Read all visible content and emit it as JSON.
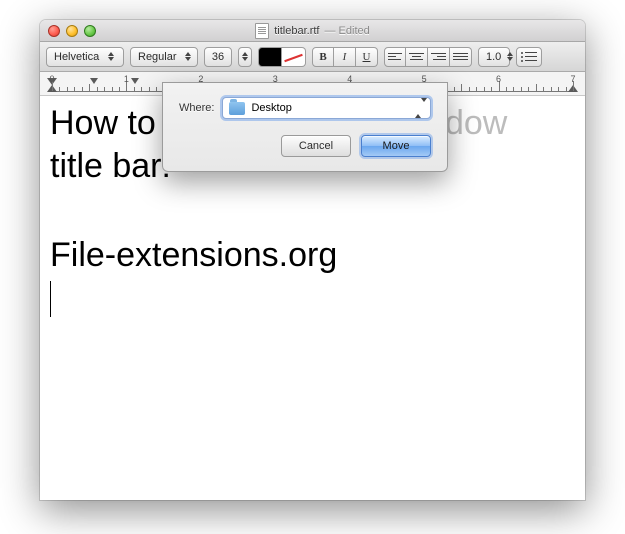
{
  "title": {
    "filename": "titlebar.rtf",
    "edited": "— Edited"
  },
  "toolbar": {
    "font_family": "Helvetica",
    "font_style": "Regular",
    "font_size": "36",
    "b": "B",
    "i": "I",
    "u": "U",
    "line_spacing": "1.0"
  },
  "ruler": {
    "labels": [
      "0",
      "1",
      "2",
      "3",
      "4",
      "5",
      "6",
      "7"
    ]
  },
  "document": {
    "line1_a": "How to",
    "line1_b": " use interactive window",
    "line2": "title bar!",
    "line3": "File-extensions.org"
  },
  "sheet": {
    "label": "Where:",
    "location": "Desktop",
    "cancel": "Cancel",
    "move": "Move"
  }
}
